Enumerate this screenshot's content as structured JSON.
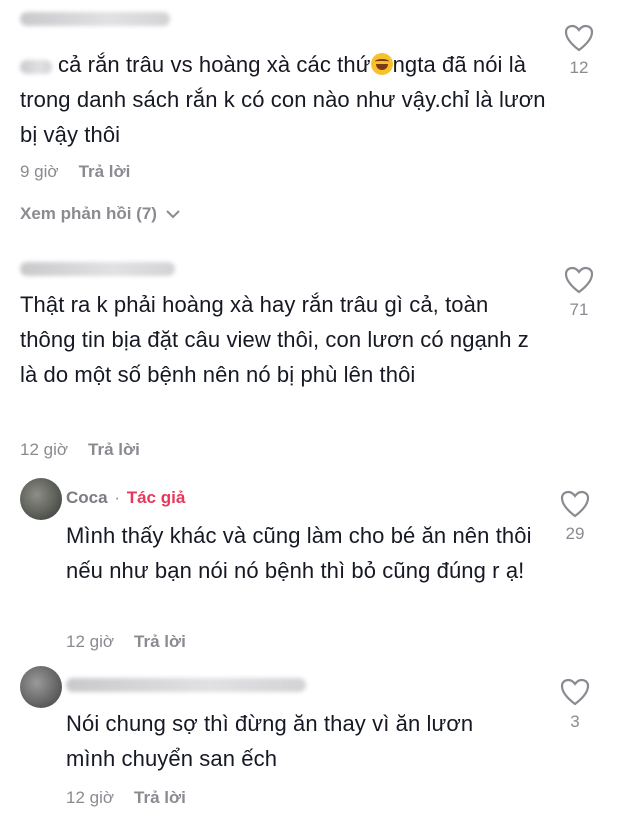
{
  "comments": [
    {
      "text_a": "cả rắn trâu vs hoàng xà các thứ",
      "emoji": "face-with-tears-of-joy",
      "text_b": "ngta đã nói là trong danh sách rắn k có con nào như vậy.chỉ là lươn bị vậy thôi",
      "time": "9 giờ",
      "reply": "Trả lời",
      "likes": "12",
      "view_replies": "Xem phản hồi (7)"
    },
    {
      "text": "Thật ra k phải hoàng xà hay rắn trâu gì cả, toàn thông tin bịa đặt câu view thôi, con lươn có ngạnh z là do một số bệnh nên nó bị phù lên thôi",
      "time": "12 giờ",
      "reply": "Trả lời",
      "likes": "71"
    }
  ],
  "replies": [
    {
      "author": "Coca",
      "separator": "·",
      "badge": "Tác giả",
      "text": "Mình thấy khác và cũng làm cho bé ăn nên thôi nếu như bạn nói nó bệnh thì bỏ cũng đúng r ạ!",
      "time": "12 giờ",
      "reply": "Trả lời",
      "likes": "29"
    },
    {
      "text": "Nói chung sợ thì đừng ăn thay vì ăn lươn mình chuyển san ếch",
      "time": "12 giờ",
      "reply": "Trả lời",
      "likes": "3"
    }
  ],
  "colors": {
    "author_badge": "#e8375a",
    "meta": "#8a8b91",
    "text": "#161823"
  }
}
